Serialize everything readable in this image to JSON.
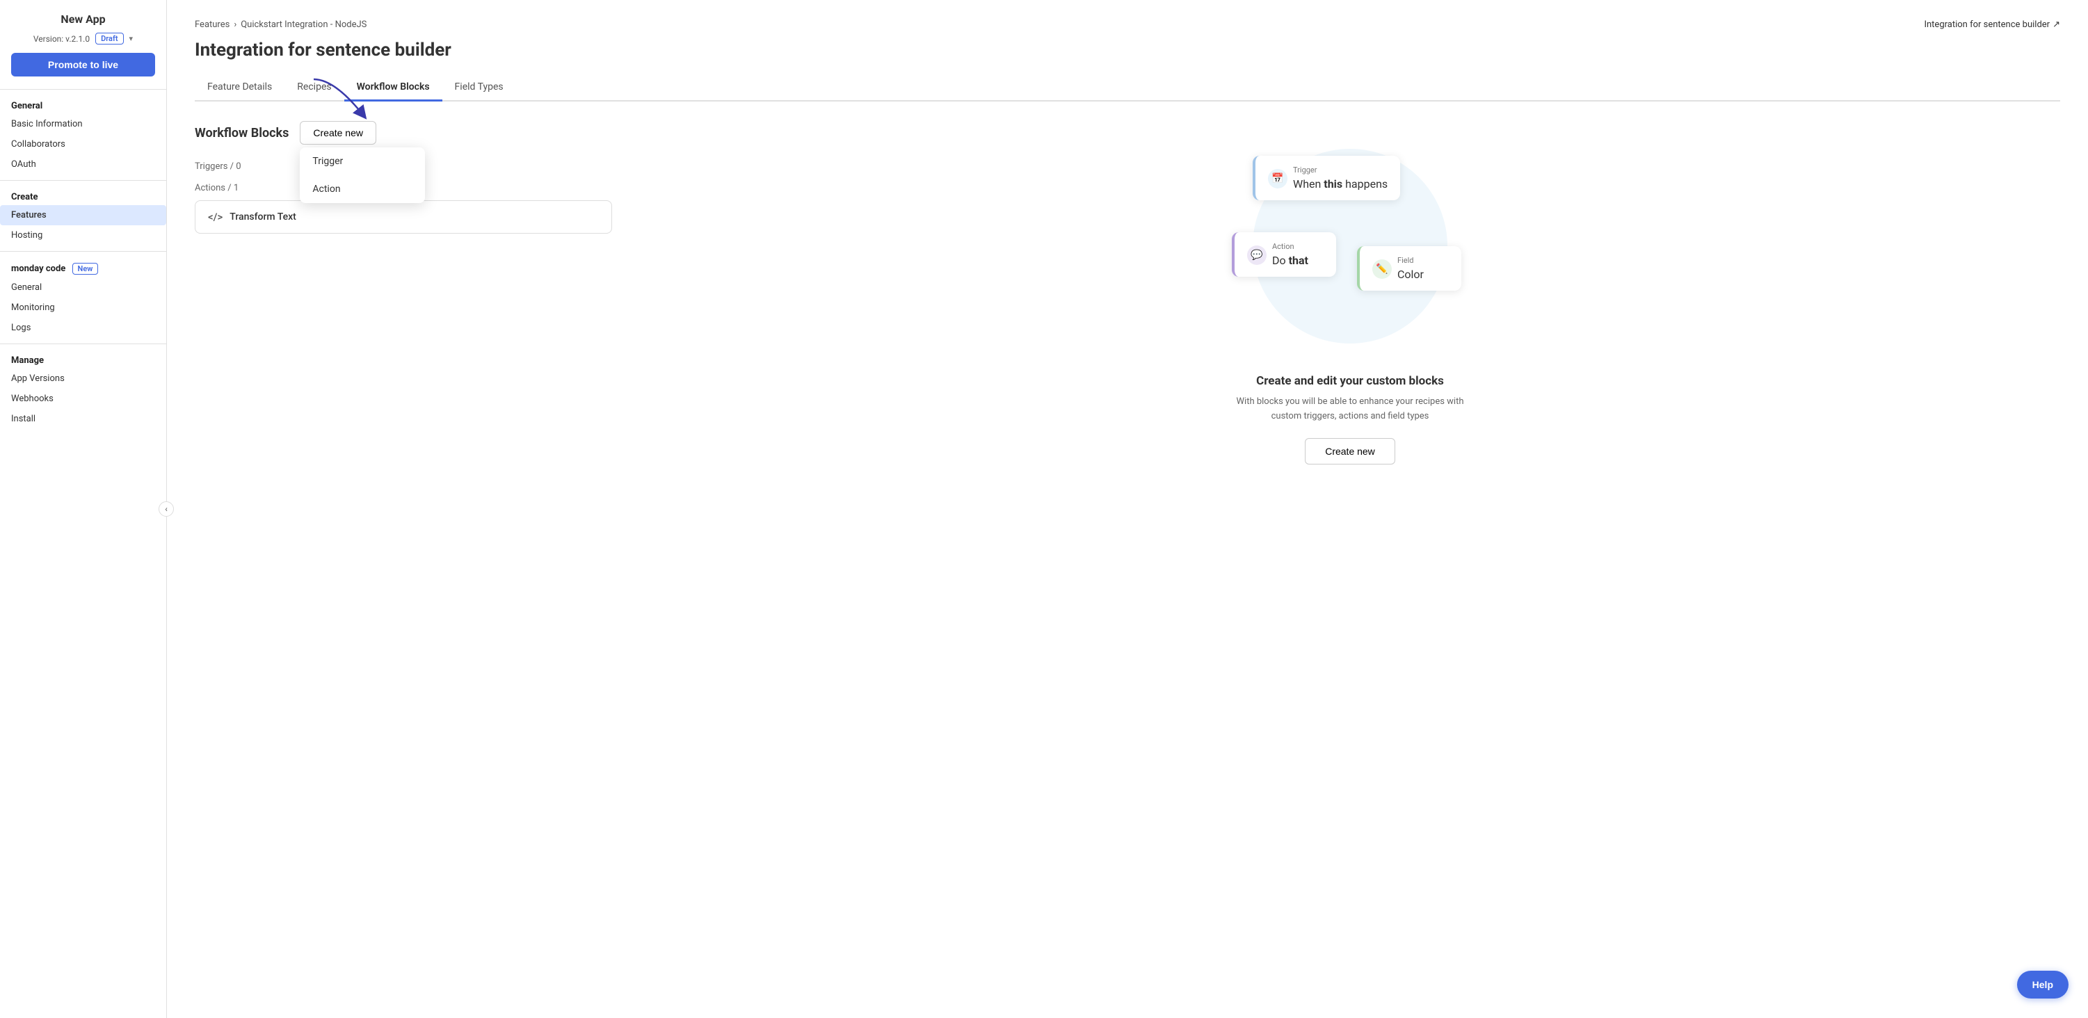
{
  "sidebar": {
    "title": "New App",
    "version_label": "Version: v.2.1.0",
    "draft_label": "Draft",
    "promote_btn": "Promote to live",
    "collapse_icon": "‹",
    "sections": [
      {
        "label": "General",
        "items": [
          {
            "id": "basic-info",
            "label": "Basic Information",
            "active": false
          },
          {
            "id": "collaborators",
            "label": "Collaborators",
            "active": false
          },
          {
            "id": "oauth",
            "label": "OAuth",
            "active": false
          }
        ]
      },
      {
        "label": "Create",
        "items": [
          {
            "id": "features",
            "label": "Features",
            "active": true
          },
          {
            "id": "hosting",
            "label": "Hosting",
            "active": false
          }
        ]
      },
      {
        "label": "monday code",
        "new_badge": "New",
        "items": [
          {
            "id": "general",
            "label": "General",
            "active": false
          },
          {
            "id": "monitoring",
            "label": "Monitoring",
            "active": false
          },
          {
            "id": "logs",
            "label": "Logs",
            "active": false
          }
        ]
      },
      {
        "label": "Manage",
        "items": [
          {
            "id": "app-versions",
            "label": "App Versions",
            "active": false
          },
          {
            "id": "webhooks",
            "label": "Webhooks",
            "active": false
          },
          {
            "id": "install",
            "label": "Install",
            "active": false
          }
        ]
      }
    ]
  },
  "header": {
    "breadcrumb_root": "Features",
    "breadcrumb_sep": "›",
    "breadcrumb_child": "Quickstart Integration - NodeJS",
    "title": "Integration for sentence builder",
    "external_link_label": "Integration for sentence builder",
    "external_link_icon": "↗"
  },
  "tabs": [
    {
      "id": "feature-details",
      "label": "Feature Details",
      "active": false
    },
    {
      "id": "recipes",
      "label": "Recipes",
      "active": false
    },
    {
      "id": "workflow-blocks",
      "label": "Workflow Blocks",
      "active": true
    },
    {
      "id": "field-types",
      "label": "Field Types",
      "active": false
    }
  ],
  "workflow": {
    "section_title": "Workflow Blocks",
    "create_new_btn": "Create new",
    "triggers_label": "Triggers / 0",
    "actions_label": "Actions / 1",
    "dropdown_items": [
      {
        "id": "trigger",
        "label": "Trigger"
      },
      {
        "id": "action",
        "label": "Action"
      }
    ],
    "action_items": [
      {
        "id": "transform-text",
        "label": "Transform Text",
        "icon": "</>"
      }
    ]
  },
  "illustration": {
    "trigger_type": "Trigger",
    "trigger_value_prefix": "When ",
    "trigger_value_bold": "this",
    "trigger_value_suffix": " happens",
    "action_type": "Action",
    "action_value_prefix": "Do ",
    "action_value_bold": "that",
    "field_type": "Field",
    "field_value": "Color"
  },
  "cta": {
    "title": "Create and edit your custom blocks",
    "description": "With blocks you will be able to enhance your recipes with custom triggers, actions and field types",
    "btn_label": "Create new"
  },
  "help_btn": "Help"
}
